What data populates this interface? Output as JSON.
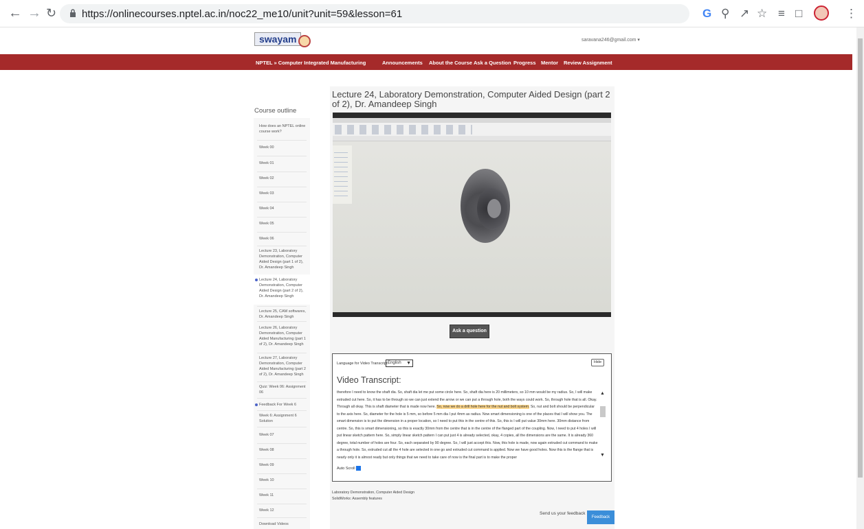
{
  "browser": {
    "url": "https://onlinecourses.nptel.ac.in/noc22_me10/unit?unit=59&lesson=61"
  },
  "header": {
    "logo": "swayam",
    "email": "saravana246@gmail.com ▾"
  },
  "topnav": {
    "breadcrumb": "NPTEL » Computer Integrated Manufacturing",
    "items": [
      "Announcements",
      "About the Course",
      "Ask a Question",
      "Progress",
      "Mentor",
      "Review Assignment"
    ]
  },
  "sidebar": {
    "title": "Course outline",
    "items": [
      "How does an NPTEL online course work?",
      "Week 00",
      "Week 01",
      "Week 02",
      "Week 03",
      "Week 04",
      "Week 05",
      "Week 06",
      "Lecture 23, Laboratory Demonstration, Computer Aided Design (part 1 of 2), Dr. Amandeep Singh",
      "Lecture 24, Laboratory Demonstration, Computer Aided Design (part 2 of 2), Dr. Amandeep Singh",
      "Lecture 25, CAM softwares, Dr. Amandeep Singh",
      "Lecture 26, Laboratory Demonstration, Computer Aided Manufacturing (part 1 of 2), Dr. Amandeep Singh",
      "Lecture 27, Laboratory Demonstration, Computer Aided Manufacturing (part 2 of 2), Dr. Amandeep Singh",
      "Quiz: Week 06: Assignment 06",
      "Feedback For Week 6",
      "Week 6: Assignment 6 Solution",
      "Week 07",
      "Week 08",
      "Week 09",
      "Week 10",
      "Week 11",
      "Week 12",
      "Download Videos"
    ]
  },
  "main": {
    "title": "Lecture 24, Laboratory Demonstration, Computer Aided Design (part 2 of 2), Dr. Amandeep Singh",
    "ask_button": "Ask a question",
    "transcript": {
      "lang_label": "Language for Video Transcript:",
      "lang_value": "English",
      "hide_button": "Hide",
      "heading": "Video Transcript:",
      "text_a": "therefore I need to know the shaft dia. So, shaft dia let me put some circle here. So, shaft dia here is 20 millimeters, so 10 mm would be my radius. So, I will make extruded cut here. So, it has to be through so we can just extend the arrow or we can put a through hole, both the ways could work. So, through hole that is all. Okay. Through all okay. This is shaft diameter that is made now here. ",
      "text_hl": "So, now we do a drill hole here for the nut and bolt system.",
      "text_b": " So, nut and bolt should be perpendicular to the axis here. So, diameter for the hole is 5 mm, so before 5 mm dia I put 4mm as radius. Now smart dimensioning is one of the places that I will show you. The smart dimension is to put the dimension in a proper location, so I need to put this in the centre of this. So, this is I will put value 30mm here. 30mm distance from centre. So, this is smart dimensioning, so this is exactly 30mm from the centre that is in the centre of the flanged part of the coupling. Now, I need to put 4 holes I will put linear sketch pattern here. So, simply linear sketch pattern I can put just 4 is already selected, okay, 4 copies, all the dimensions are the same. It is already 360 degree, total number of holes are four. So, each separated by 90 degree. So, I will just accept this. Now, this hole is made, now again extruded cut command to make a through hole. So, extruded cut all the 4 hole are selected in one go and extruded cut command is applied. Now we have good holes. Now this is the flange that is nearly only it is almost ready but only things that we need to take care of now is the final part is to make the proper",
      "autoscroll": "Auto Scroll"
    },
    "meta_line1": "Laboratory Demonstration, Computer Aided Design",
    "meta_line2": "SolidWorks: Assembly features",
    "send_feedback": "Send us your feedback",
    "feedback_button": "Feedback"
  }
}
